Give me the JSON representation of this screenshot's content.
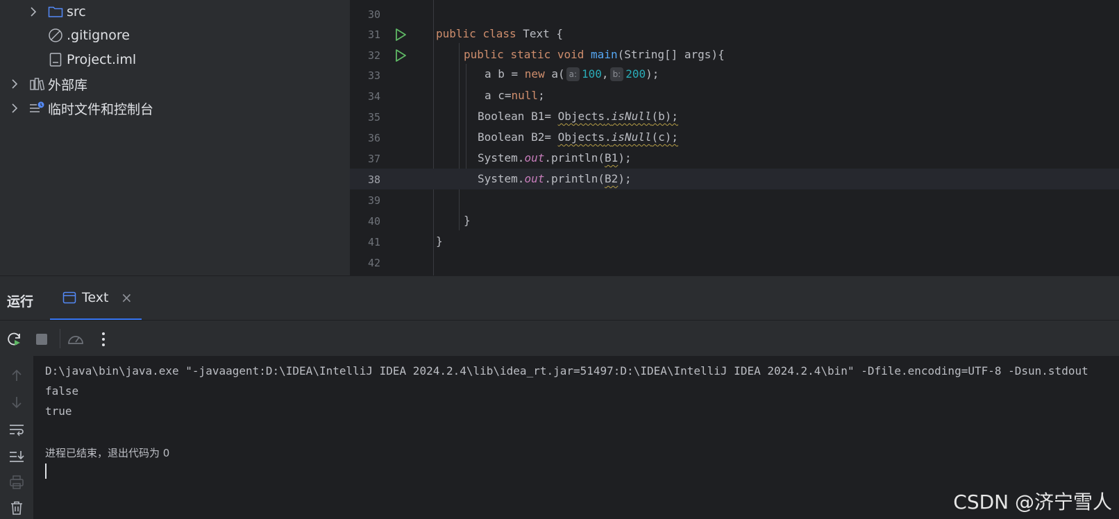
{
  "project_tree": {
    "items": [
      {
        "label": "src",
        "icon": "folder-icon",
        "expandable": true
      },
      {
        "label": ".gitignore",
        "icon": "ignored-file-icon",
        "expandable": false
      },
      {
        "label": "Project.iml",
        "icon": "module-file-icon",
        "expandable": false
      },
      {
        "label": "外部库",
        "icon": "library-icon",
        "expandable": true
      },
      {
        "label": "临时文件和控制台",
        "icon": "scratches-icon",
        "expandable": true
      }
    ]
  },
  "editor": {
    "line_numbers": [
      "30",
      "31",
      "32",
      "33",
      "34",
      "35",
      "36",
      "37",
      "38",
      "39",
      "40",
      "41",
      "42"
    ],
    "current_line": "38",
    "tokens": {
      "public": "public",
      "class": "class",
      "static": "static",
      "void": "void",
      "new": "new",
      "null": "null",
      "class_name": "Text",
      "method_name": "main",
      "params": "(String[] args){",
      "brace_open": " {",
      "l33_pre": "a b = ",
      "l33_call": " a(",
      "hint_a": "a:",
      "num_100": "100",
      "comma": ",",
      "hint_b": "b:",
      "num_200": "200",
      "l33_end": ");",
      "l34_pre": "a c=",
      "semi": ";",
      "boolean_b1": "Boolean B1= ",
      "boolean_b2": "Boolean B2= ",
      "objects": "Objects",
      "dot": ".",
      "is_null": "isNull",
      "arg_b": "(b);",
      "arg_c": "(c);",
      "system": "System.",
      "out": "out",
      "println": ".println(",
      "b1": "B1",
      "b2": "B2",
      "close_call": ");",
      "close_brace": "}"
    }
  },
  "run_window": {
    "title": "运行",
    "tab_label": "Text",
    "tab_close": "×",
    "console_lines": [
      "D:\\java\\bin\\java.exe \"-javaagent:D:\\IDEA\\IntelliJ IDEA 2024.2.4\\lib\\idea_rt.jar=51497:D:\\IDEA\\IntelliJ IDEA 2024.2.4\\bin\" -Dfile.encoding=UTF-8 -Dsun.stdout",
      "false",
      "true",
      "",
      "进程已结束，退出代码为 0"
    ]
  },
  "watermark": "CSDN @济宁雪人",
  "colors": {
    "background": "#1e1f22",
    "panel": "#2b2d30",
    "accent": "#3574f0",
    "keyword": "#cf8e6d",
    "function": "#56a8f5",
    "number": "#2aacb8",
    "static_field": "#c77dbb",
    "run_green": "#5fb865"
  }
}
